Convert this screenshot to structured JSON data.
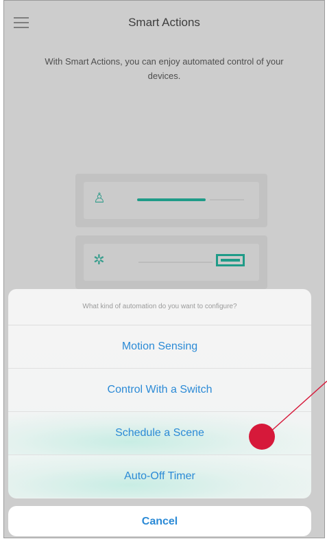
{
  "header": {
    "title": "Smart Actions",
    "menu_icon": "hamburger-menu-icon"
  },
  "intro": {
    "text": "With Smart Actions, you can enjoy automated control of your devices."
  },
  "illustration": {
    "cards": [
      {
        "icon": "motion-sensor-icon",
        "glyph": "♙"
      },
      {
        "icon": "switch-icon",
        "glyph": "✲"
      }
    ],
    "accent_color": "#1f9b88"
  },
  "action_sheet": {
    "prompt": "What kind of automation do you want to configure?",
    "options": [
      {
        "label": "Motion Sensing"
      },
      {
        "label": "Control With a Switch"
      },
      {
        "label": "Schedule a Scene"
      },
      {
        "label": "Auto-Off Timer"
      }
    ],
    "cancel_label": "Cancel",
    "link_color": "#2b8ad6"
  },
  "annotation": {
    "marker_color": "#d6193a",
    "target": "Schedule a Scene"
  }
}
